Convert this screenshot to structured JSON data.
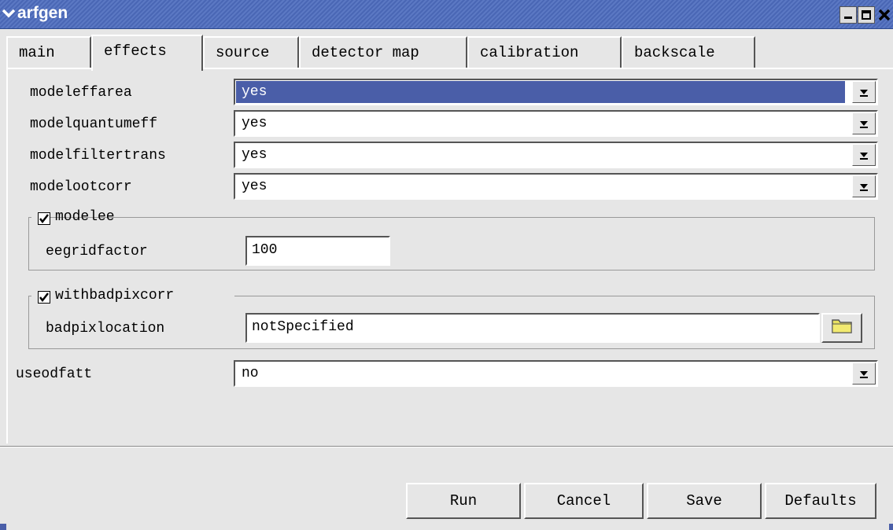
{
  "window": {
    "title": "arfgen"
  },
  "tabs": [
    {
      "label": "main"
    },
    {
      "label": "effects"
    },
    {
      "label": "source"
    },
    {
      "label": "detector map"
    },
    {
      "label": "calibration"
    },
    {
      "label": "backscale"
    }
  ],
  "fields": {
    "modeleffarea": {
      "label": "modeleffarea",
      "value": "yes"
    },
    "modelquantumeff": {
      "label": "modelquantumeff",
      "value": "yes"
    },
    "modelfiltertrans": {
      "label": "modelfiltertrans",
      "value": "yes"
    },
    "modelootcorr": {
      "label": "modelootcorr",
      "value": "yes"
    },
    "modelee": {
      "label": "modelee",
      "checked": true
    },
    "eegridfactor": {
      "label": "eegridfactor",
      "value": "100"
    },
    "withbadpixcorr": {
      "label": "withbadpixcorr",
      "checked": true
    },
    "badpixlocation": {
      "label": "badpixlocation",
      "value": "notSpecified"
    },
    "useodfatt": {
      "label": "useodfatt",
      "value": "no"
    }
  },
  "buttons": {
    "run": "Run",
    "cancel": "Cancel",
    "save": "Save",
    "defaults": "Defaults"
  },
  "colors": {
    "titlebar": "#4a67b5",
    "selection": "#4a5ea8",
    "background": "#e6e6e6"
  }
}
